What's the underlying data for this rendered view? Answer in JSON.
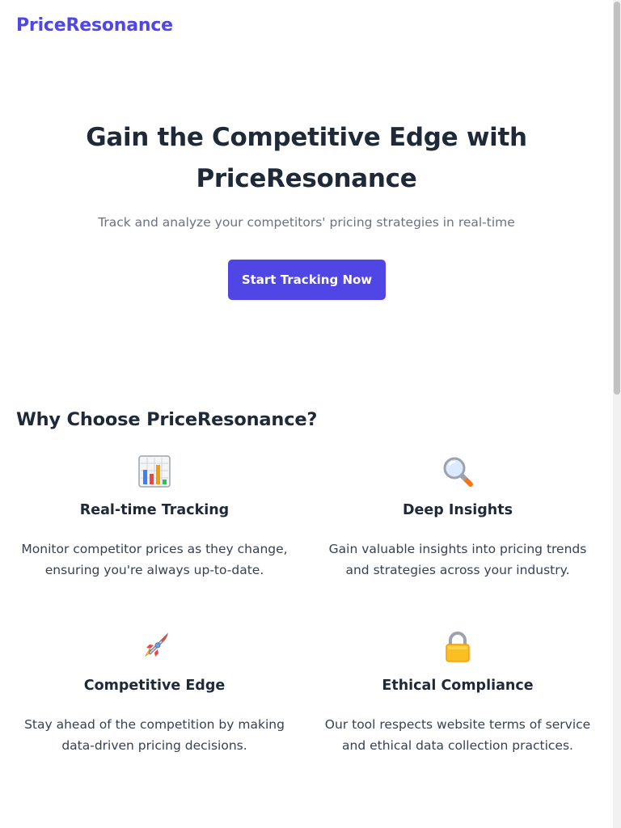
{
  "header": {
    "brand": "PriceResonance"
  },
  "hero": {
    "title": "Gain the Competitive Edge with PriceResonance",
    "subtitle": "Track and analyze your competitors' pricing strategies in real-time",
    "cta_label": "Start Tracking Now",
    "cta_color": "#4f46e5"
  },
  "features_section": {
    "title": "Why Choose PriceResonance?",
    "items": [
      {
        "icon": "bar-chart-icon",
        "title": "Real-time Tracking",
        "description": "Monitor competitor prices as they change, ensuring you're always up-to-date."
      },
      {
        "icon": "magnifying-glass-icon",
        "title": "Deep Insights",
        "description": "Gain valuable insights into pricing trends and strategies across your industry."
      },
      {
        "icon": "rocket-icon",
        "title": "Competitive Edge",
        "description": "Stay ahead of the competition by making data-driven pricing decisions."
      },
      {
        "icon": "lock-icon",
        "title": "Ethical Compliance",
        "description": "Our tool respects website terms of service and ethical data collection practices."
      }
    ]
  },
  "colors": {
    "brand": "#4f46e5",
    "heading": "#1f2937",
    "muted_text": "#6b7280",
    "body_text": "#374151",
    "background": "#ffffff"
  }
}
